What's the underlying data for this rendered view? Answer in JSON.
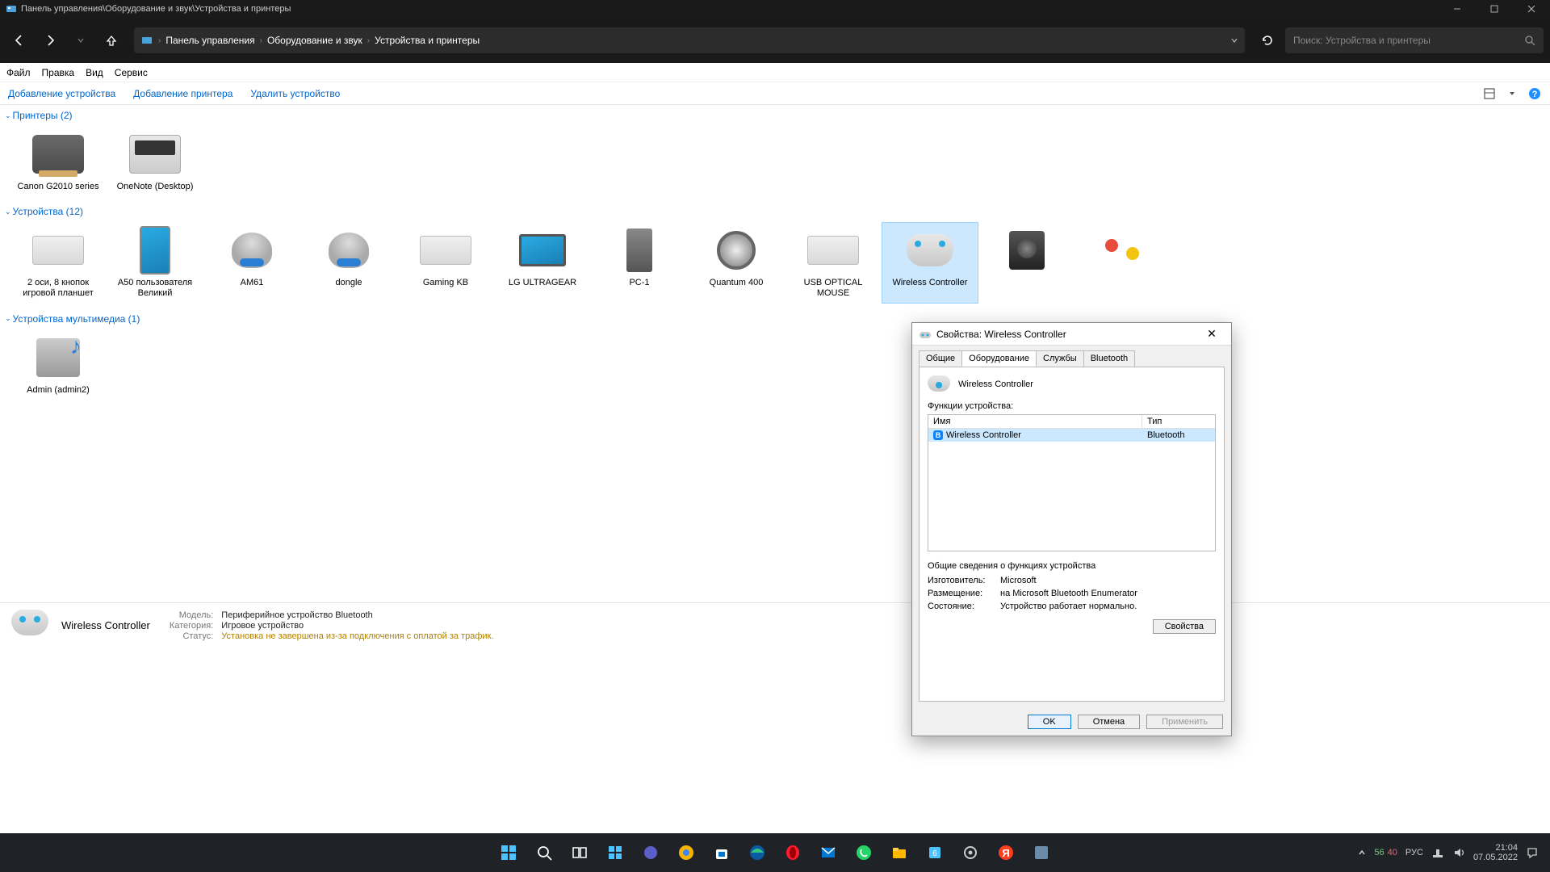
{
  "titlebar": {
    "path": "Панель управления\\Оборудование и звук\\Устройства и принтеры"
  },
  "breadcrumb": {
    "p1": "Панель управления",
    "p2": "Оборудование и звук",
    "p3": "Устройства и принтеры"
  },
  "search": {
    "placeholder": "Поиск: Устройства и принтеры"
  },
  "menu": {
    "file": "Файл",
    "edit": "Правка",
    "view": "Вид",
    "service": "Сервис"
  },
  "toolbar": {
    "add_device": "Добавление устройства",
    "add_printer": "Добавление принтера",
    "remove_device": "Удалить устройство"
  },
  "sections": {
    "printers": "Принтеры (2)",
    "devices": "Устройства (12)",
    "multimedia": "Устройства мультимедиа (1)"
  },
  "printers": [
    {
      "name": "Canon G2010 series"
    },
    {
      "name": "OneNote (Desktop)"
    }
  ],
  "devices": [
    {
      "name": "2 оси, 8 кнопок игровой планшет"
    },
    {
      "name": "A50 пользователя Великий"
    },
    {
      "name": "AM61"
    },
    {
      "name": "dongle"
    },
    {
      "name": "Gaming KB"
    },
    {
      "name": "LG ULTRAGEAR"
    },
    {
      "name": "PC-1"
    },
    {
      "name": "Quantum 400"
    },
    {
      "name": "USB OPTICAL MOUSE"
    },
    {
      "name": "Wireless Controller"
    }
  ],
  "multimedia": [
    {
      "name": "Admin (admin2)"
    }
  ],
  "details": {
    "title": "Wireless Controller",
    "model_k": "Модель:",
    "model_v": "Периферийное устройство Bluetooth",
    "category_k": "Категория:",
    "category_v": "Игровое устройство",
    "status_k": "Статус:",
    "status_v": "Установка не завершена из-за подключения с оплатой за трафик."
  },
  "dialog": {
    "title": "Свойства: Wireless Controller",
    "tabs": {
      "general": "Общие",
      "hardware": "Оборудование",
      "services": "Службы",
      "bluetooth": "Bluetooth"
    },
    "device_name": "Wireless Controller",
    "functions_label": "Функции устройства:",
    "col_name": "Имя",
    "col_type": "Тип",
    "row_name": "Wireless Controller",
    "row_type": "Bluetooth",
    "info_header": "Общие сведения о функциях устройства",
    "manufacturer_k": "Изготовитель:",
    "manufacturer_v": "Microsoft",
    "location_k": "Размещение:",
    "location_v": "на Microsoft Bluetooth Enumerator",
    "state_k": "Состояние:",
    "state_v": "Устройство работает нормально.",
    "properties_btn": "Свойства",
    "ok": "OK",
    "cancel": "Отмена",
    "apply": "Применить"
  },
  "tray": {
    "temp1": "56",
    "temp2": "40",
    "lang": "РУС",
    "time": "21:04",
    "date": "07.05.2022"
  }
}
